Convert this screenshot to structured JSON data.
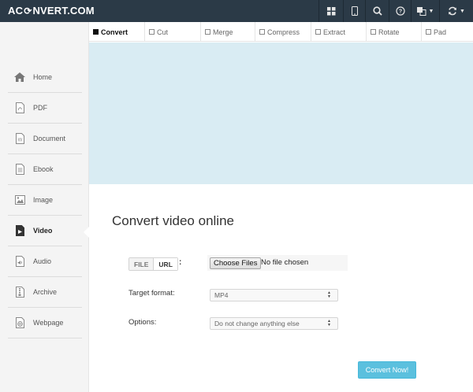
{
  "header": {
    "logo_pre": "AC",
    "logo_post": "NVERT.COM"
  },
  "sidebar": {
    "items": [
      {
        "label": "Home",
        "icon": "home-icon"
      },
      {
        "label": "PDF",
        "icon": "pdf-icon"
      },
      {
        "label": "Document",
        "icon": "document-icon"
      },
      {
        "label": "Ebook",
        "icon": "ebook-icon"
      },
      {
        "label": "Image",
        "icon": "image-icon"
      },
      {
        "label": "Video",
        "icon": "video-icon",
        "active": true
      },
      {
        "label": "Audio",
        "icon": "audio-icon"
      },
      {
        "label": "Archive",
        "icon": "archive-icon"
      },
      {
        "label": "Webpage",
        "icon": "webpage-icon"
      }
    ]
  },
  "tabs": [
    {
      "label": "Convert",
      "active": true
    },
    {
      "label": "Cut"
    },
    {
      "label": "Merge"
    },
    {
      "label": "Compress"
    },
    {
      "label": "Extract"
    },
    {
      "label": "Rotate"
    },
    {
      "label": "Pad"
    }
  ],
  "main": {
    "heading": "Convert video online",
    "source_toggle": {
      "file": "FILE",
      "url": "URL",
      "separator": ":"
    },
    "file_input": {
      "button": "Choose Files",
      "status": "No file chosen"
    },
    "target_format": {
      "label": "Target format:",
      "value": "MP4"
    },
    "options": {
      "label": "Options:",
      "value": "Do not change anything else"
    },
    "convert_button": "Convert Now!"
  },
  "colors": {
    "topbar": "#2b3a47",
    "banner": "#d9ecf3",
    "accent": "#5bc0de"
  }
}
